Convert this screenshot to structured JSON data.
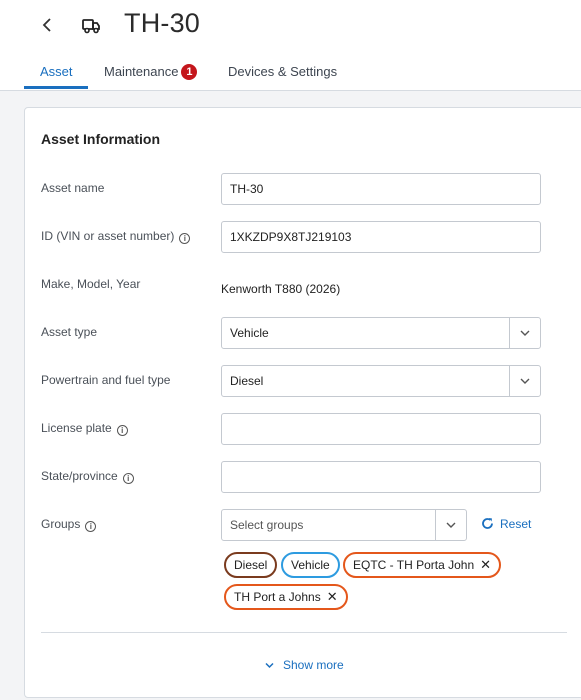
{
  "header": {
    "title": "TH-30",
    "back_icon": "chevron-left-icon",
    "asset_icon": "truck-icon"
  },
  "tabs": [
    {
      "label": "Asset",
      "active": true
    },
    {
      "label": "Maintenance",
      "badge": "1"
    },
    {
      "label": "Devices & Settings"
    }
  ],
  "card": {
    "title": "Asset Information",
    "fields": {
      "asset_name": {
        "label": "Asset name",
        "value": "TH-30"
      },
      "id": {
        "label": "ID (VIN or asset number)",
        "value": "1XKZDP9X8TJ219103"
      },
      "make": {
        "label": "Make, Model, Year",
        "value": "Kenworth T880 (2026)"
      },
      "asset_type": {
        "label": "Asset type",
        "value": "Vehicle"
      },
      "powertrain": {
        "label": "Powertrain and fuel type",
        "value": "Diesel"
      },
      "license_plate": {
        "label": "License plate",
        "value": ""
      },
      "state": {
        "label": "State/province",
        "value": ""
      },
      "groups": {
        "label": "Groups",
        "placeholder": "Select groups"
      }
    },
    "reset_label": "Reset",
    "chips": [
      {
        "label": "Diesel",
        "color": "#7a3b1e",
        "removable": false
      },
      {
        "label": "Vehicle",
        "color": "#2d9be0",
        "removable": false
      },
      {
        "label": "EQTC - TH Porta John",
        "color": "#e4571b",
        "removable": true
      },
      {
        "label": "TH Port a Johns",
        "color": "#e4571b",
        "removable": true
      }
    ],
    "show_more_label": "Show more"
  },
  "colors": {
    "accent": "#1a6fbf",
    "badge": "#c4161c"
  }
}
